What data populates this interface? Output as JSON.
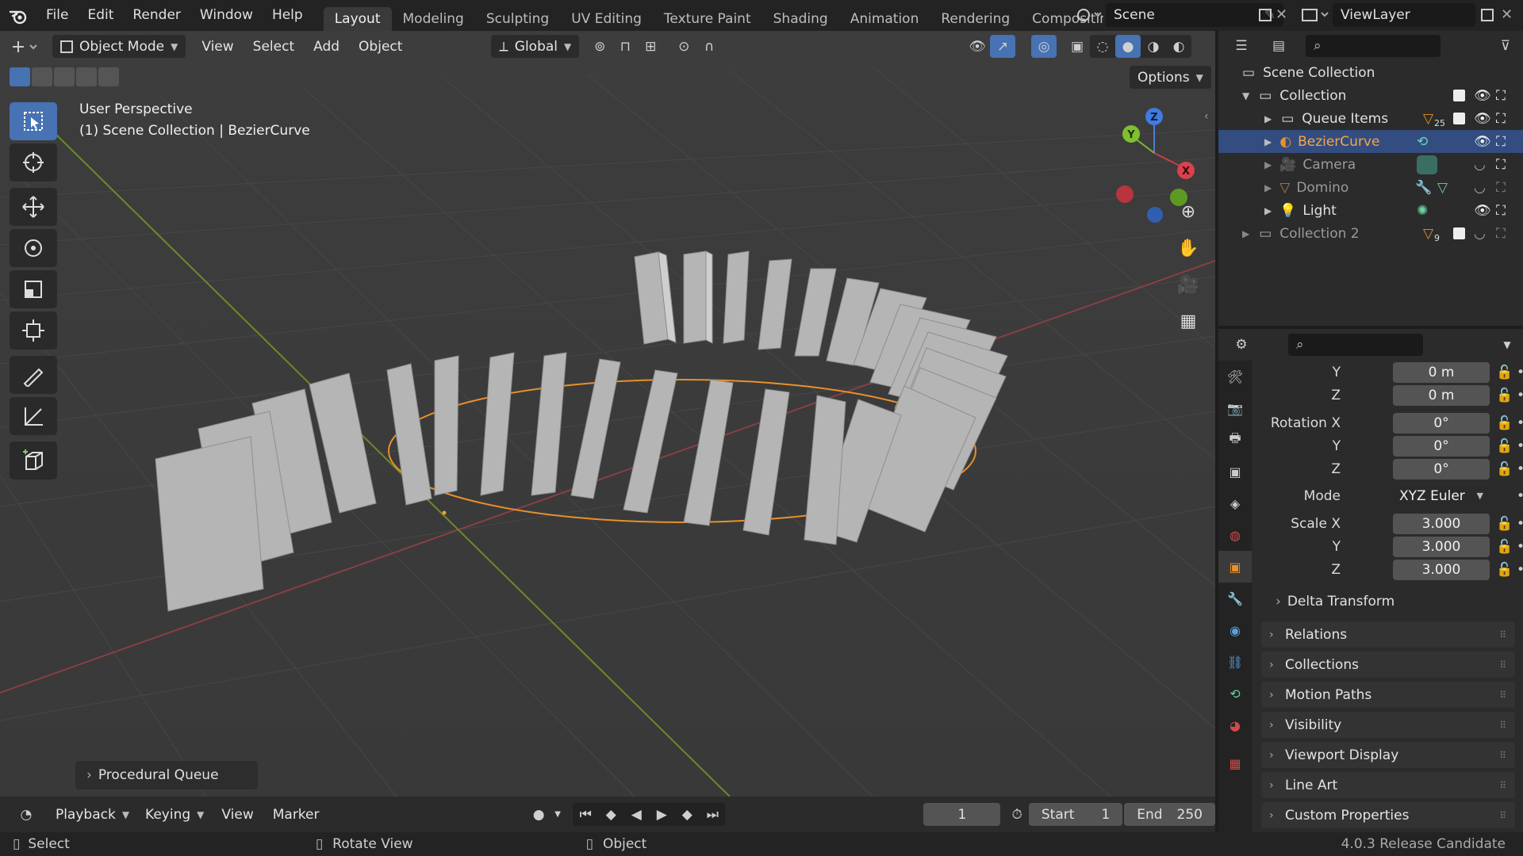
{
  "menu": {
    "file": "File",
    "edit": "Edit",
    "render": "Render",
    "window": "Window",
    "help": "Help"
  },
  "workspaces": [
    "Layout",
    "Modeling",
    "Sculpting",
    "UV Editing",
    "Texture Paint",
    "Shading",
    "Animation",
    "Rendering",
    "Compositin"
  ],
  "scene": {
    "name": "Scene",
    "view_layer": "ViewLayer"
  },
  "viewport": {
    "mode": "Object Mode",
    "menus": [
      "View",
      "Select",
      "Add",
      "Object"
    ],
    "transform_orientation": "Global",
    "options": "Options",
    "overlay_line1": "User Perspective",
    "overlay_line2": "(1) Scene Collection | BezierCurve",
    "last_op": "Procedural Queue",
    "gizmo": {
      "x": "X",
      "y": "Y",
      "z": "Z"
    }
  },
  "outliner": {
    "root": "Scene Collection",
    "rows": [
      {
        "label": "Collection"
      },
      {
        "label": "Queue Items",
        "count": "25"
      },
      {
        "label": "BezierCurve"
      },
      {
        "label": "Camera"
      },
      {
        "label": "Domino"
      },
      {
        "label": "Light"
      },
      {
        "label": "Collection 2",
        "count": "9"
      }
    ]
  },
  "properties": {
    "loc_y_label": "Y",
    "loc_y": "0 m",
    "loc_z_label": "Z",
    "loc_z": "0 m",
    "rot_x_label": "Rotation X",
    "rot_x": "0°",
    "rot_y_label": "Y",
    "rot_y": "0°",
    "rot_z_label": "Z",
    "rot_z": "0°",
    "mode_label": "Mode",
    "mode": "XYZ Euler",
    "scale_x_label": "Scale X",
    "scale_x": "3.000",
    "scale_y_label": "Y",
    "scale_y": "3.000",
    "scale_z_label": "Z",
    "scale_z": "3.000",
    "delta": "Delta Transform",
    "panels": [
      "Relations",
      "Collections",
      "Motion Paths",
      "Visibility",
      "Viewport Display",
      "Line Art",
      "Custom Properties"
    ]
  },
  "timeline": {
    "playback": "Playback",
    "keying": "Keying",
    "view": "View",
    "marker": "Marker",
    "current_frame": "1",
    "start_label": "Start",
    "start": "1",
    "end_label": "End",
    "end": "250"
  },
  "status": {
    "select": "Select",
    "rotate": "Rotate View",
    "object": "Object",
    "version": "4.0.3 Release Candidate"
  }
}
